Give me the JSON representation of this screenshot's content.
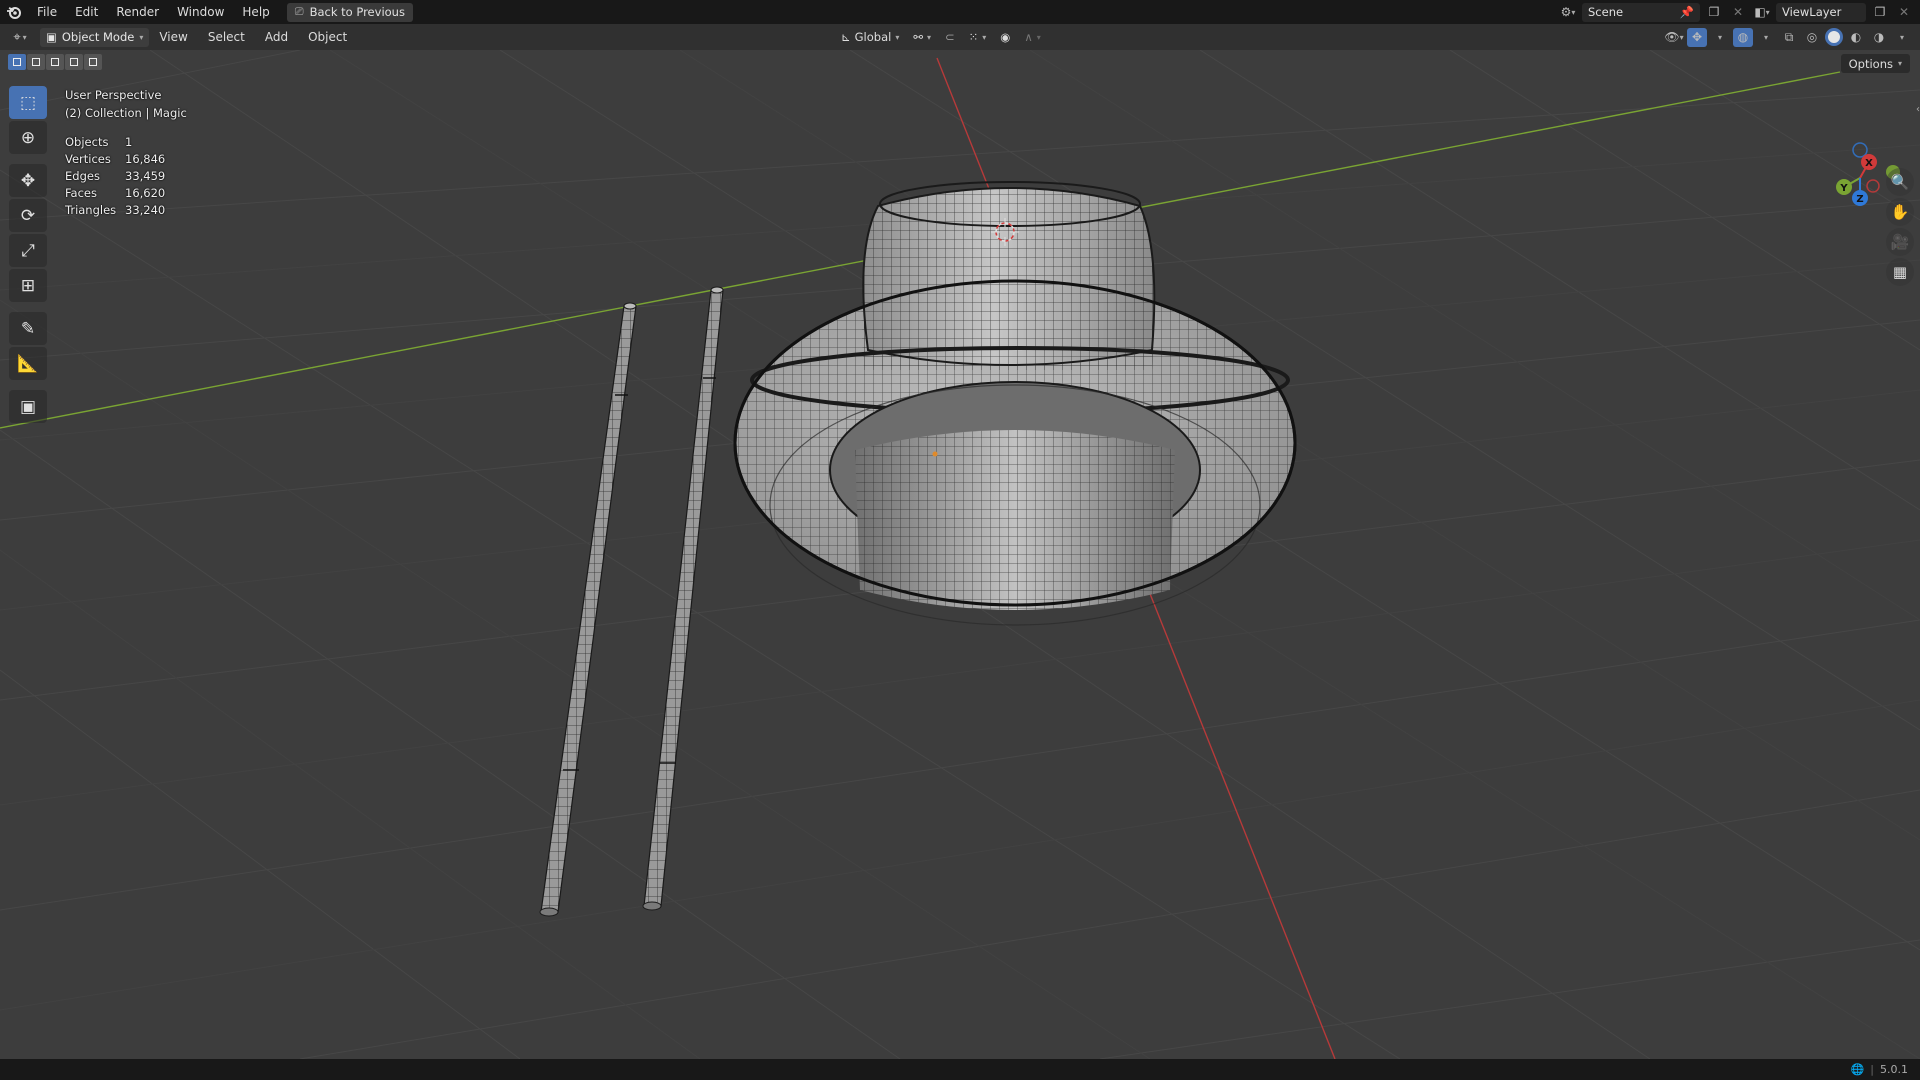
{
  "topbar": {
    "menus": [
      "File",
      "Edit",
      "Render",
      "Window",
      "Help"
    ],
    "back_label": "Back to Previous",
    "scene_name": "Scene",
    "view_layer": "ViewLayer"
  },
  "header": {
    "mode": "Object Mode",
    "menus": [
      "View",
      "Select",
      "Add",
      "Object"
    ],
    "transform_orientation": "Global"
  },
  "viewport": {
    "perspective": "User Perspective",
    "collection": "(2) Collection | Magic",
    "options_label": "Options",
    "stats": [
      {
        "label": "Objects",
        "value": "1"
      },
      {
        "label": "Vertices",
        "value": "16,846"
      },
      {
        "label": "Edges",
        "value": "33,459"
      },
      {
        "label": "Faces",
        "value": "16,620"
      },
      {
        "label": "Triangles",
        "value": "33,240"
      }
    ],
    "gizmo": {
      "x": "X",
      "y": "Y",
      "z": "Z"
    }
  },
  "statusbar": {
    "version": "5.0.1"
  },
  "colors": {
    "accent": "#4772b3",
    "axis_x": "#d13a3a",
    "axis_y": "#7aa433",
    "axis_z": "#2f79d8"
  }
}
